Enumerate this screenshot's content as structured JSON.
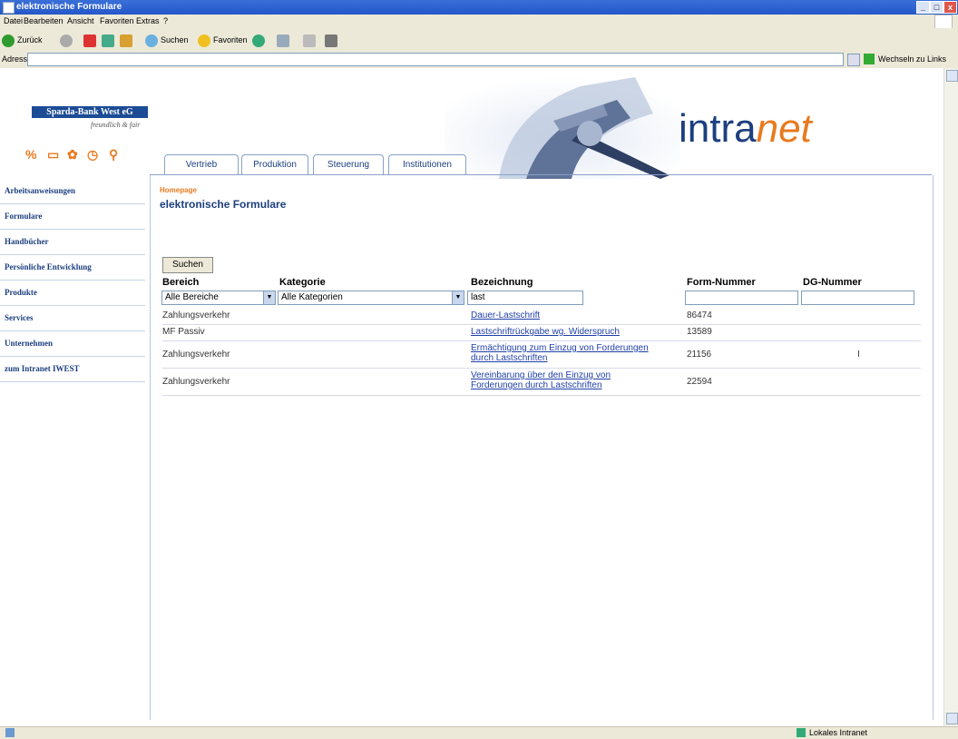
{
  "window": {
    "title": "elektronische Formulare",
    "buttons": [
      "_",
      "□",
      "x"
    ]
  },
  "menu": [
    "Datei",
    "Bearbeiten",
    "Ansicht",
    "Favoriten",
    "Extras",
    "?"
  ],
  "toolbar": {
    "back": "Zurück",
    "search": "Suchen",
    "favorites": "Favoriten"
  },
  "addressbar": {
    "label": "Adresse",
    "value": "",
    "go": "Wechseln zu",
    "links": "Links"
  },
  "bank": {
    "name": "Sparda-Bank West eG",
    "slogan": "freundlich & fair"
  },
  "brand": {
    "intra": "intra",
    "net": "net"
  },
  "tabs": [
    "Vertrieb",
    "Produktion",
    "Steuerung",
    "Institutionen"
  ],
  "sidebar": [
    "Arbeitsanweisungen",
    "Formulare",
    "Handbücher",
    "Persönliche Entwicklung",
    "Produkte",
    "Services",
    "Unternehmen",
    "zum Intranet IWEST"
  ],
  "breadcrumb": "Homepage",
  "page_title": "elektronische Formulare",
  "search_button": "Suchen",
  "columns": [
    "Bereich",
    "Kategorie",
    "Bezeichnung",
    "Form-Nummer",
    "DG-Nummer"
  ],
  "filters": {
    "bereich": "Alle Bereiche",
    "kategorie": "Alle Kategorien",
    "bezeichnung": "last",
    "form_nummer": "",
    "dg_nummer": ""
  },
  "rows": [
    {
      "bereich": "Zahlungsverkehr",
      "bezeichnung": "Dauer-Lastschrift",
      "form": "86474",
      "dg": ""
    },
    {
      "bereich": "MF Passiv",
      "bezeichnung": "Lastschriftrückgabe wg. Widerspruch",
      "form": "13589",
      "dg": ""
    },
    {
      "bereich": "Zahlungsverkehr",
      "bezeichnung_l1": "Ermächtigung zum Einzug von Forderungen",
      "bezeichnung_l2": "durch Lastschriften",
      "form": "21156",
      "dg": "I"
    },
    {
      "bereich": "Zahlungsverkehr",
      "bezeichnung_l1": "Vereinbarung über den Einzug von",
      "bezeichnung_l2": "Forderungen durch Lastschriften",
      "form": "22594",
      "dg": ""
    }
  ],
  "status": "Lokales Intranet",
  "colors": {
    "brand_blue": "#1c3f7f",
    "accent_orange": "#e87a1e",
    "link": "#1f3fa8"
  }
}
